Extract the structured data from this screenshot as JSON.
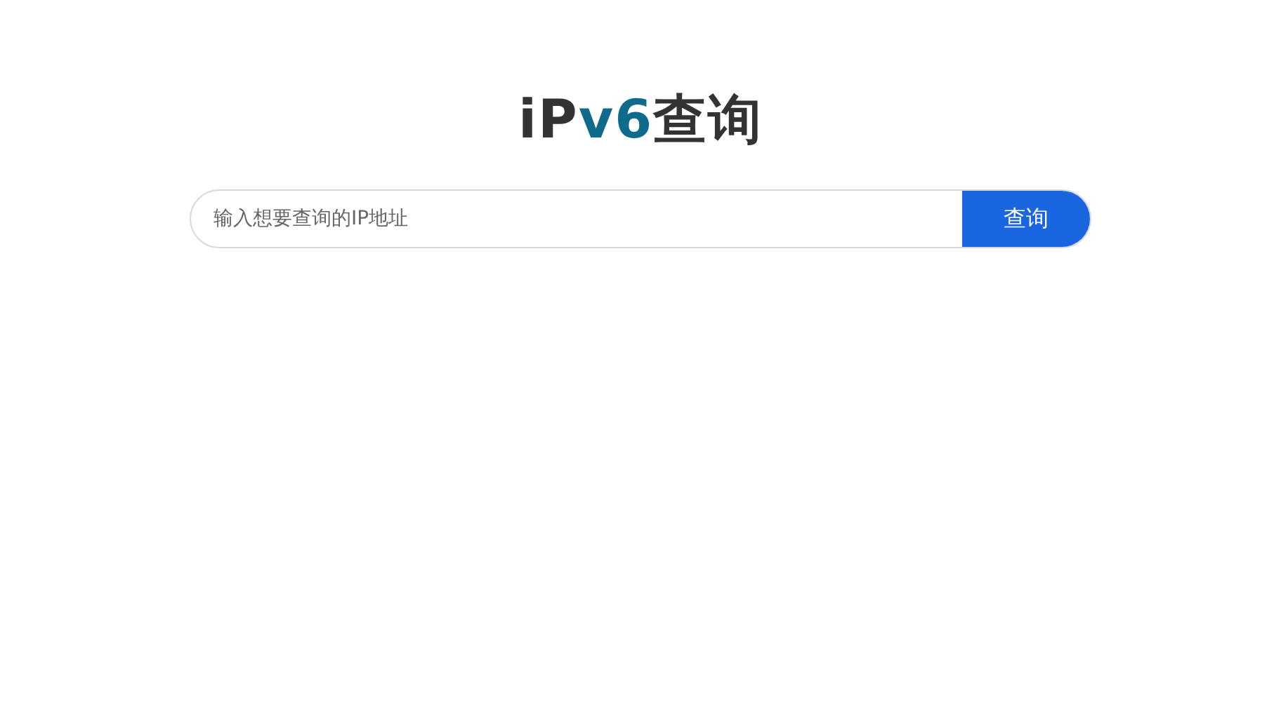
{
  "logo": {
    "parts": [
      {
        "text": "iP",
        "highlight": false
      },
      {
        "text": "v6",
        "highlight": true
      },
      {
        "text": "查询",
        "highlight": false
      }
    ]
  },
  "search": {
    "placeholder": "输入想要查询的IP地址",
    "button": "查询"
  }
}
